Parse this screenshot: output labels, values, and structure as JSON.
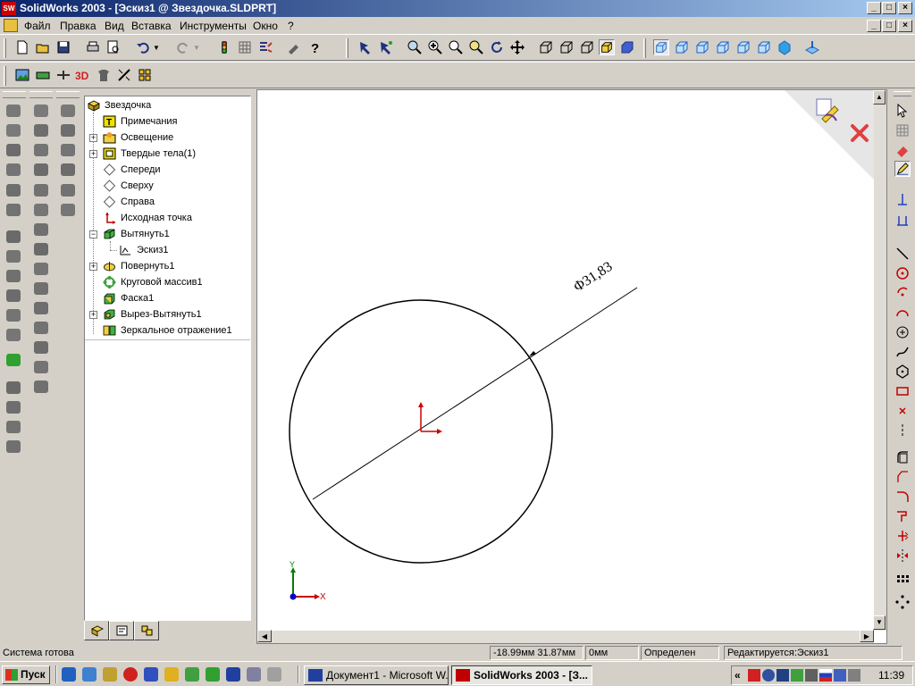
{
  "window": {
    "app_title": "SolidWorks 2003 - [Эскиз1 @ Звездочка.SLDPRT]",
    "logo_text": "SW"
  },
  "menu": {
    "items": [
      "Файл",
      "Правка",
      "Вид",
      "Вставка",
      "Инструменты",
      "Окно",
      "?"
    ]
  },
  "feature_tree": {
    "items": [
      {
        "label": "Звездочка",
        "icon": "part-icon"
      },
      {
        "label": "Примечания",
        "icon": "annotations-icon"
      },
      {
        "label": "Освещение",
        "icon": "lighting-icon"
      },
      {
        "label": "Твердые тела(1)",
        "icon": "solid-bodies-icon"
      },
      {
        "label": "Спереди",
        "icon": "plane-icon"
      },
      {
        "label": "Сверху",
        "icon": "plane-icon"
      },
      {
        "label": "Справа",
        "icon": "plane-icon"
      },
      {
        "label": "Исходная точка",
        "icon": "origin-icon"
      },
      {
        "label": "Вытянуть1",
        "icon": "extrude-icon"
      },
      {
        "label": "Эскиз1",
        "icon": "sketch-icon"
      },
      {
        "label": "Повернуть1",
        "icon": "revolve-icon"
      },
      {
        "label": "Круговой массив1",
        "icon": "circular-pattern-icon"
      },
      {
        "label": "Фаска1",
        "icon": "chamfer-icon"
      },
      {
        "label": "Вырез-Вытянуть1",
        "icon": "cut-extrude-icon"
      },
      {
        "label": "Зеркальное отражение1",
        "icon": "mirror-icon"
      }
    ]
  },
  "drawing": {
    "dimension_label": "31,83",
    "diameter_symbol": "Φ",
    "axis_x": "X",
    "axis_y": "Y"
  },
  "status": {
    "ready": "Система готова",
    "coords": "-18.99мм 31.87мм",
    "z": "0мм",
    "state": "Определен",
    "editing": "Редактируется:Эскиз1"
  },
  "taskbar": {
    "start": "Пуск",
    "tasks": [
      {
        "label": "Документ1 - Microsoft W...",
        "icon": "word-icon"
      },
      {
        "label": "SolidWorks 2003 - [З...",
        "icon": "solidworks-icon"
      }
    ],
    "clock": "11:39",
    "tray_toggle": "«"
  },
  "colors": {
    "title_start": "#0a246a",
    "title_end": "#a6caf0",
    "panel": "#d4d0c8",
    "viewport": "#ffffff",
    "sketch_line": "#000000",
    "origin_red": "#cc0000",
    "axis_green": "#008000",
    "axis_blue": "#0000cc"
  }
}
